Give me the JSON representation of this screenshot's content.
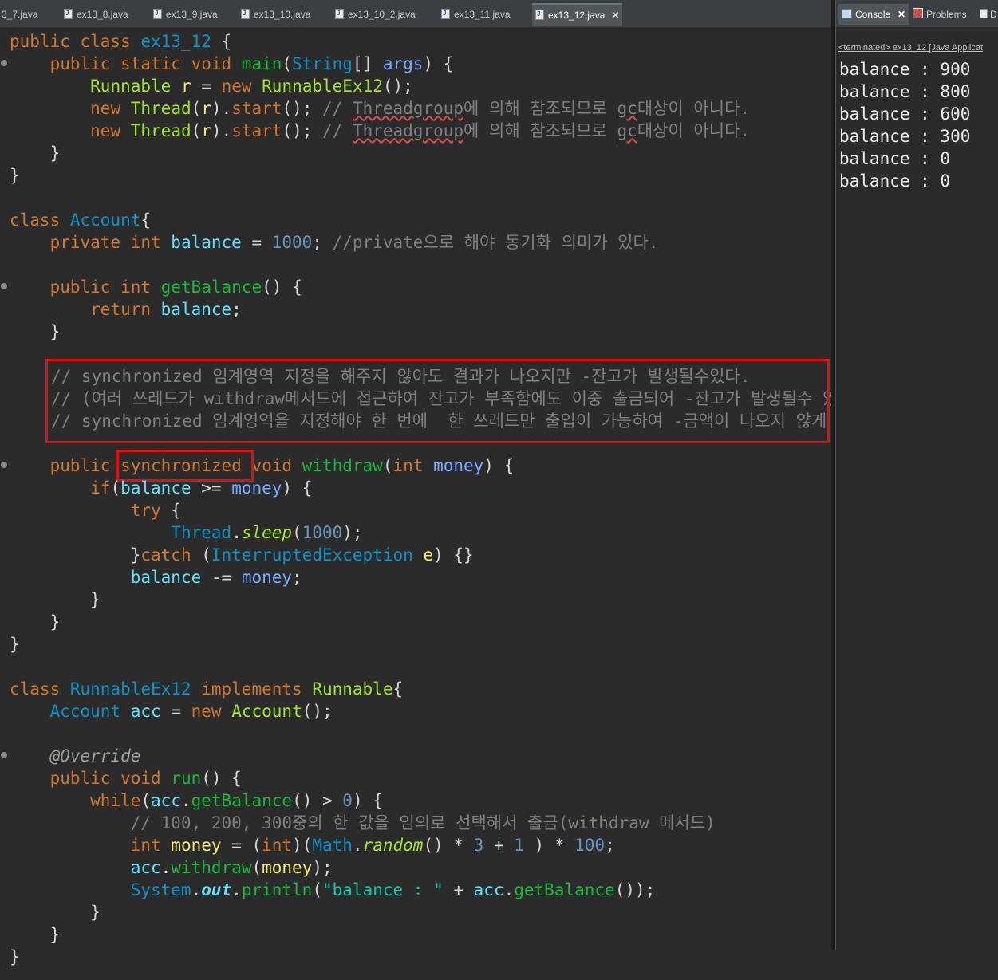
{
  "editor_tabs": [
    {
      "label": "3_7.java",
      "active": false
    },
    {
      "label": "ex13_8.java",
      "active": false
    },
    {
      "label": "ex13_9.java",
      "active": false
    },
    {
      "label": "ex13_10.java",
      "active": false
    },
    {
      "label": "ex13_10_2.java",
      "active": false
    },
    {
      "label": "ex13_11.java",
      "active": false
    },
    {
      "label": "ex13_12.java",
      "active": true
    }
  ],
  "close_glyph": "✕",
  "code": {
    "l1": {
      "a": "public class ",
      "b": "ex13_12",
      "c": " {"
    },
    "l2": {
      "a": "    public static void ",
      "b": "main",
      "c": "(",
      "d": "String",
      "e": "[] ",
      "f": "args",
      "g": ") {"
    },
    "l3": {
      "a": "        ",
      "b": "Runnable",
      "c": " ",
      "d": "r",
      "e": " = ",
      "f": "new",
      "g": " ",
      "h": "RunnableEx12",
      "i": "();"
    },
    "l4": {
      "a": "        ",
      "b": "new",
      "c": " ",
      "d": "Thread",
      "e": "(",
      "f": "r",
      "g": ").",
      "h": "start",
      "i": "(); ",
      "j": "// ",
      "k": "Threadgroup",
      "l": "에 의해 참조되므로 ",
      "m": "gc",
      "n": "대상이 아니다."
    },
    "l5": {
      "a": "        ",
      "b": "new",
      "c": " ",
      "d": "Thread",
      "e": "(",
      "f": "r",
      "g": ").",
      "h": "start",
      "i": "(); ",
      "j": "// ",
      "k": "Threadgroup",
      "l": "에 의해 참조되므로 ",
      "m": "gc",
      "n": "대상이 아니다."
    },
    "l6": "    }",
    "l7": "}",
    "l9": {
      "a": "class ",
      "b": "Account",
      "c": "{"
    },
    "l10": {
      "a": "    private int ",
      "b": "balance",
      "c": " = ",
      "d": "1000",
      "e": "; ",
      "f": "//private으로 해야 동기화 의미가 있다."
    },
    "l12": {
      "a": "    public int ",
      "b": "getBalance",
      "c": "() {"
    },
    "l13": {
      "a": "        return ",
      "b": "balance",
      "c": ";"
    },
    "l14": "    }",
    "l16": "// synchronized 임계영역 지정을 해주지 않아도 결과가 나오지만 -잔고가 발생될수있다.",
    "l17": "// (여러 쓰레드가 withdraw메서드에 접근하여 잔고가 부족함에도 이중 출금되어 -잔고가 발생될수 있다.)",
    "l18": "// synchronized 임계영역을 지정해야 한 번에  한 쓰레드만 출입이 가능하여 -금액이 나오지 않게 된다.",
    "l20": {
      "a": "    public ",
      "b": "synchronized",
      "c": " void ",
      "d": "withdraw",
      "e": "(",
      "f": "int",
      "g": " ",
      "h": "money",
      "i": ") {"
    },
    "l21": {
      "a": "        ",
      "b": "if",
      "c": "(",
      "d": "balance",
      "e": " >= ",
      "f": "money",
      "g": ") {"
    },
    "l22": {
      "a": "            ",
      "b": "try",
      "c": " {"
    },
    "l23": {
      "a": "                ",
      "b": "Thread",
      "c": ".",
      "d": "sleep",
      "e": "(",
      "f": "1000",
      "g": ");"
    },
    "l24": {
      "a": "            }",
      "b": "catch",
      "c": " (",
      "d": "InterruptedException",
      "e": " ",
      "f": "e",
      "g": ") {}"
    },
    "l25": {
      "a": "            ",
      "b": "balance",
      "c": " -= ",
      "d": "money",
      "e": ";"
    },
    "l26": "        }",
    "l27": "    }",
    "l28": "}",
    "l30": {
      "a": "class ",
      "b": "RunnableEx12",
      "c": " ",
      "d": "implements",
      "e": " ",
      "f": "Runnable",
      "g": "{"
    },
    "l31": {
      "a": "    ",
      "b": "Account",
      "c": " ",
      "d": "acc",
      "e": " = ",
      "f": "new",
      "g": " ",
      "h": "Account",
      "i": "();"
    },
    "l33": "    @Override",
    "l34": {
      "a": "    public void ",
      "b": "run",
      "c": "() {"
    },
    "l35": {
      "a": "        ",
      "b": "while",
      "c": "(",
      "d": "acc",
      "e": ".",
      "f": "getBalance",
      "g": "() > ",
      "h": "0",
      "i": ") {"
    },
    "l36": "            // 100, 200, 300중의 한 값을 임의로 선택해서 출금(withdraw 메서드)",
    "l37": {
      "a": "            ",
      "b": "int",
      "c": " ",
      "d": "money",
      "e": " = (",
      "f": "int",
      "g": ")(",
      "h": "Math",
      "i": ".",
      "j": "random",
      "k": "() * ",
      "l": "3",
      "m": " + ",
      "n": "1",
      "o": " ) * ",
      "p": "100",
      "q": ";"
    },
    "l38": {
      "a": "            ",
      "b": "acc",
      "c": ".",
      "d": "withdraw",
      "e": "(",
      "f": "money",
      "g": ");"
    },
    "l39": {
      "a": "            ",
      "b": "System",
      "c": ".",
      "d": "out",
      "e": ".",
      "f": "println",
      "g": "(",
      "h": "\"balance : \"",
      "i": " + ",
      "j": "acc",
      "k": ".",
      "l": "getBalance",
      "m": "());"
    },
    "l40": "        }",
    "l41": "    }",
    "l42": "}"
  },
  "console": {
    "tabs": [
      {
        "label": "Console",
        "active": true
      },
      {
        "label": "Problems",
        "active": false
      },
      {
        "label": "D",
        "active": false
      }
    ],
    "terminated": "<terminated> ex13_12 [Java Applicat",
    "output": [
      "balance : 900",
      "balance : 800",
      "balance : 600",
      "balance : 300",
      "balance : 0",
      "balance : 0"
    ]
  }
}
